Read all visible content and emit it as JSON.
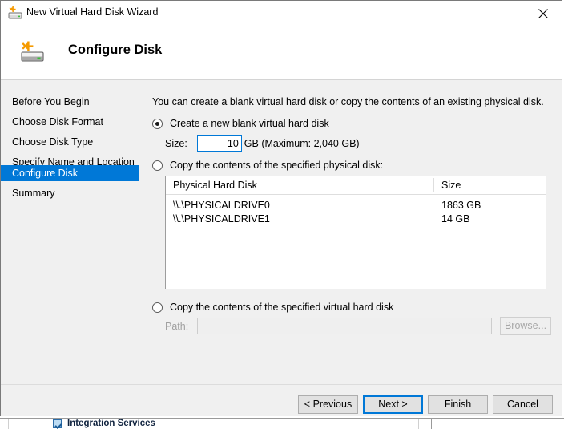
{
  "window": {
    "title": "New Virtual Hard Disk Wizard",
    "title_icon": "new-hard-disk-icon",
    "close_icon": "close-icon"
  },
  "header": {
    "icon": "new-hard-disk-icon",
    "title": "Configure Disk"
  },
  "sidebar": {
    "items": [
      {
        "label": "Before You Begin",
        "selected": false
      },
      {
        "label": "Choose Disk Format",
        "selected": false
      },
      {
        "label": "Choose Disk Type",
        "selected": false
      },
      {
        "label": "Specify Name and Location",
        "selected": false
      },
      {
        "label": "Configure Disk",
        "selected": true
      },
      {
        "label": "Summary",
        "selected": false
      }
    ],
    "selected_color": "#0078d7"
  },
  "main": {
    "intro": "You can create a blank virtual hard disk or copy the contents of an existing physical disk.",
    "options": {
      "create_blank": {
        "label": "Create a new blank virtual hard disk",
        "selected": true
      },
      "copy_physical": {
        "label": "Copy the contents of the specified physical disk:",
        "selected": false
      },
      "copy_virtual": {
        "label": "Copy the contents of the specified virtual hard disk",
        "selected": false
      }
    },
    "size_field": {
      "label": "Size:",
      "value": "10",
      "suffix": "GB (Maximum: 2,040 GB)",
      "focused": true,
      "focus_color": "#0078d7"
    },
    "physical_disk_table": {
      "columns": [
        "Physical Hard Disk",
        "Size"
      ],
      "rows": [
        {
          "disk": "\\\\.\\PHYSICALDRIVE0",
          "size": "1863 GB"
        },
        {
          "disk": "\\\\.\\PHYSICALDRIVE1",
          "size": "14 GB"
        }
      ]
    },
    "path_field": {
      "label": "Path:",
      "value": "",
      "placeholder": "",
      "disabled": true
    },
    "browse_button": {
      "label": "Browse...",
      "disabled": true
    }
  },
  "footer": {
    "buttons": [
      {
        "label": "< Previous",
        "default": false
      },
      {
        "label": "Next >",
        "default": true
      },
      {
        "label": "Finish",
        "default": false
      },
      {
        "label": "Cancel",
        "default": false
      }
    ]
  },
  "background_window": {
    "row_label": "Integration Services"
  }
}
